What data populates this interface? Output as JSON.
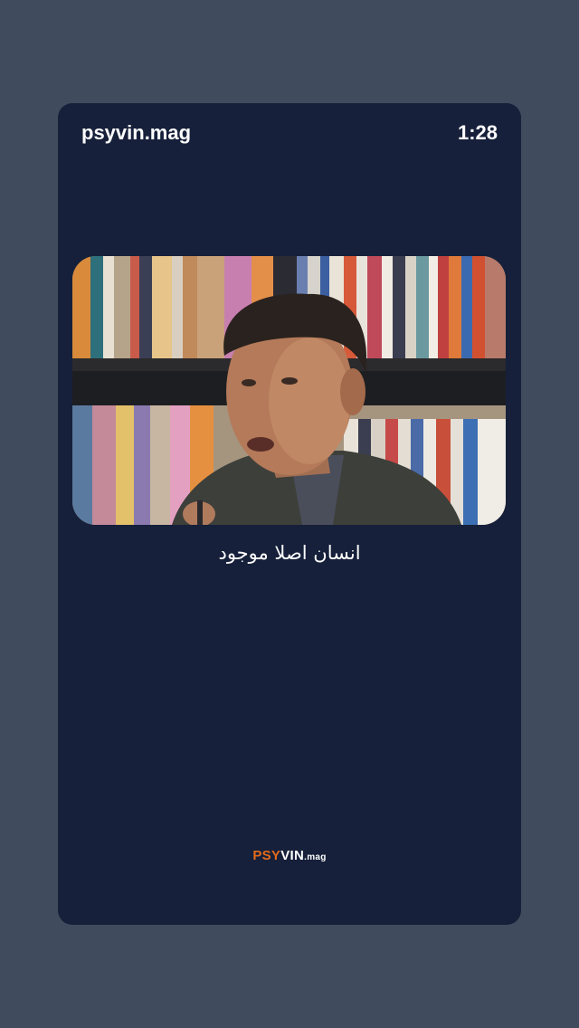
{
  "header": {
    "handle": "psyvin.mag",
    "duration": "1:28"
  },
  "caption": "انسان اصلا موجود",
  "logo": {
    "part1": "PSY",
    "part2": "VIN",
    "part3": ".mag"
  },
  "colors": {
    "page_background": "#414b5e",
    "card_background": "#16203a",
    "brand_orange": "#e36a1a",
    "text": "#ffffff"
  },
  "icons": {
    "video": "video-thumbnail"
  }
}
